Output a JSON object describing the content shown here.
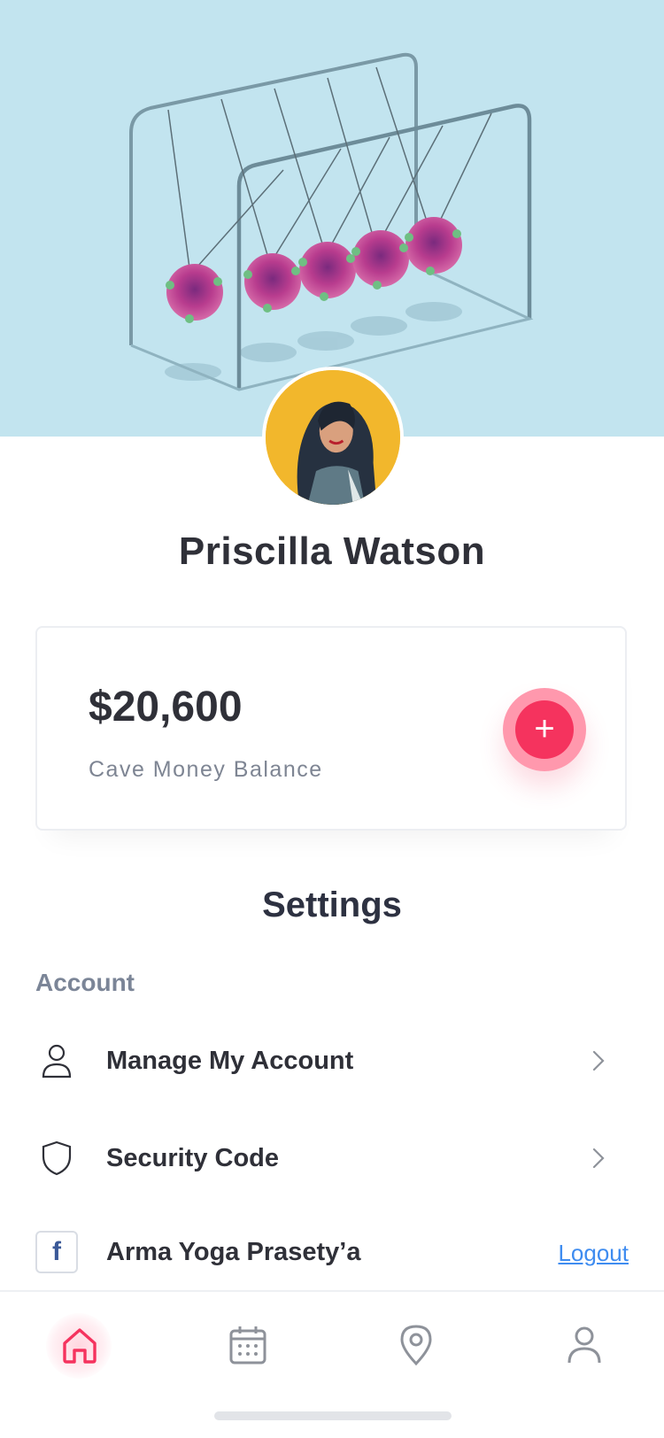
{
  "profile": {
    "name": "Priscilla Watson"
  },
  "balance": {
    "amount": "$20,600",
    "label": "Cave Money Balance",
    "add_symbol": "+"
  },
  "settings": {
    "title": "Settings",
    "section_label": "Account",
    "items": [
      {
        "label": "Manage My Account",
        "icon": "user-icon",
        "action": "chevron-right-icon"
      },
      {
        "label": "Security Code",
        "icon": "shield-icon",
        "action": "chevron-right-icon"
      },
      {
        "label": "Arma Yoga Prasety’a",
        "icon": "facebook-icon",
        "action_label": "Logout"
      }
    ]
  },
  "nav": {
    "items": [
      {
        "name": "home",
        "icon": "home-icon",
        "active": true
      },
      {
        "name": "calendar",
        "icon": "calendar-icon",
        "active": false
      },
      {
        "name": "location",
        "icon": "map-pin-icon",
        "active": false
      },
      {
        "name": "profile",
        "icon": "user-icon",
        "active": false
      }
    ]
  },
  "colors": {
    "accent": "#f5335e",
    "accent_ring": "#ff98ad",
    "hero_bg": "#c2e4ef",
    "link": "#3f8cf0",
    "muted": "#7b8597",
    "icon_gray": "#8e929a"
  }
}
